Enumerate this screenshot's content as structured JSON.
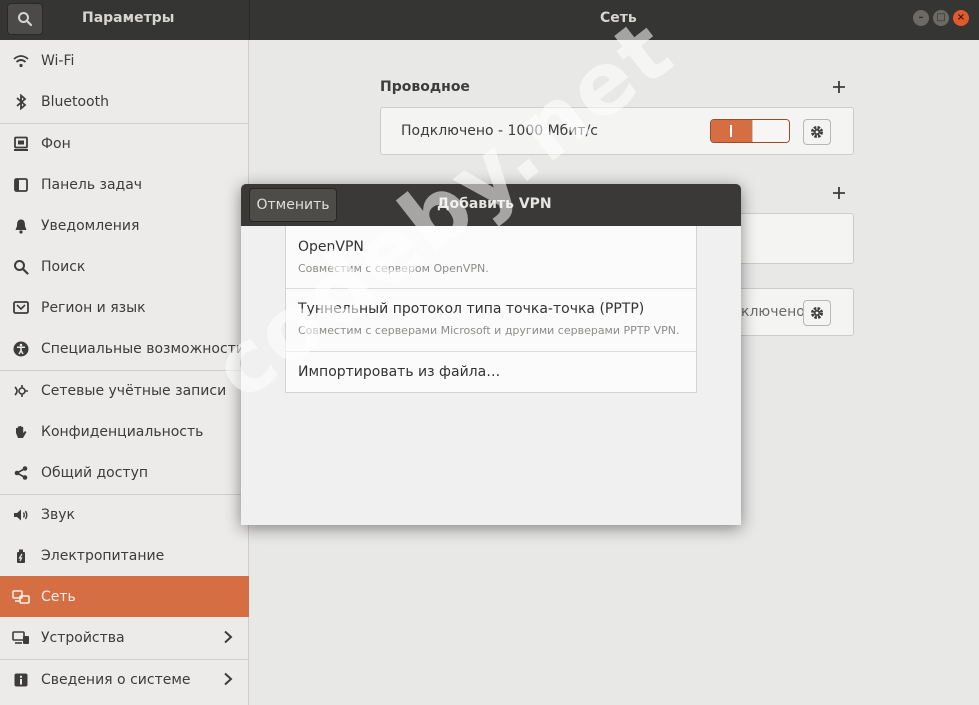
{
  "header": {
    "left_title": "Параметры",
    "title": "Сеть"
  },
  "sidebar": {
    "items": [
      {
        "label": "Wi-Fi",
        "icon": "wifi-icon"
      },
      {
        "label": "Bluetooth",
        "icon": "bluetooth-icon"
      },
      {
        "label": "Фон",
        "icon": "background-icon"
      },
      {
        "label": "Панель задач",
        "icon": "dock-icon"
      },
      {
        "label": "Уведомления",
        "icon": "bell-icon"
      },
      {
        "label": "Поиск",
        "icon": "search-icon"
      },
      {
        "label": "Регион и язык",
        "icon": "region-icon"
      },
      {
        "label": "Специальные возможности",
        "icon": "accessibility-icon"
      },
      {
        "label": "Сетевые учётные записи",
        "icon": "online-accounts-icon"
      },
      {
        "label": "Конфиденциальность",
        "icon": "privacy-hand-icon"
      },
      {
        "label": "Общий доступ",
        "icon": "share-icon"
      },
      {
        "label": "Звук",
        "icon": "speaker-icon"
      },
      {
        "label": "Электропитание",
        "icon": "power-icon"
      },
      {
        "label": "Сеть",
        "icon": "network-icon",
        "selected": true
      },
      {
        "label": "Устройства",
        "icon": "devices-icon",
        "chevron": true
      },
      {
        "label": "Сведения о системе",
        "icon": "info-icon",
        "chevron": true
      }
    ]
  },
  "main": {
    "wired": {
      "title": "Проводное",
      "status": "Подключено - 1000 Мбит/с",
      "toggle_on": true
    },
    "proxy_status_partial": "ключено"
  },
  "dialog": {
    "cancel_label": "Отменить",
    "title": "Добавить VPN",
    "options": [
      {
        "title": "OpenVPN",
        "subtitle": "Совместим с сервером OpenVPN."
      },
      {
        "title": "Туннельный протокол типа точка-точка (PPTP)",
        "subtitle": "Совместим с серверами Microsoft и другими серверами PPTP VPN."
      },
      {
        "title": "Импортировать из файла…"
      }
    ]
  },
  "watermark": "codeby.net",
  "colors": {
    "accent": "#d56e43",
    "headerbar": "#353534"
  }
}
